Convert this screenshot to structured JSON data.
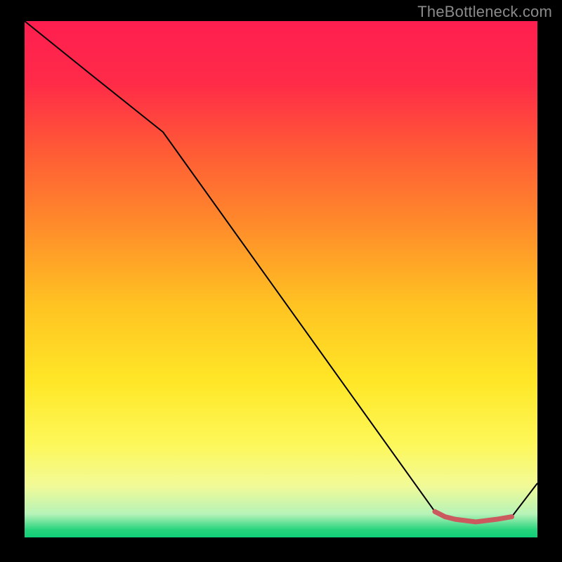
{
  "watermark": "TheBottleneck.com",
  "chart_data": {
    "type": "line",
    "title": "",
    "xlabel": "",
    "ylabel": "",
    "xlim": [
      0,
      100
    ],
    "ylim": [
      0,
      100
    ],
    "grid": false,
    "legend": false,
    "gradient_stops": [
      {
        "offset": 0.0,
        "color": "#ff1e50"
      },
      {
        "offset": 0.12,
        "color": "#ff2b48"
      },
      {
        "offset": 0.25,
        "color": "#ff5a36"
      },
      {
        "offset": 0.4,
        "color": "#ff8d2a"
      },
      {
        "offset": 0.55,
        "color": "#ffc322"
      },
      {
        "offset": 0.7,
        "color": "#ffe727"
      },
      {
        "offset": 0.82,
        "color": "#fdf85a"
      },
      {
        "offset": 0.9,
        "color": "#f2fa97"
      },
      {
        "offset": 0.955,
        "color": "#b6f3b8"
      },
      {
        "offset": 0.985,
        "color": "#28d47e"
      },
      {
        "offset": 1.0,
        "color": "#0fcf79"
      }
    ],
    "series": [
      {
        "name": "curve",
        "color": "#000000",
        "stroke_width": 2,
        "x": [
          0.0,
          12.5,
          27.0,
          80.0,
          82.0,
          84.0,
          88.0,
          92.0,
          95.0,
          100.0
        ],
        "values": [
          100.0,
          90.0,
          78.5,
          5.0,
          4.0,
          3.5,
          3.0,
          3.5,
          4.0,
          10.5
        ]
      },
      {
        "name": "valley-highlight",
        "color": "#cb5a5f",
        "stroke_width": 7,
        "linecap": "round",
        "x": [
          80.0,
          82.0,
          84.0,
          88.0,
          92.0,
          95.0
        ],
        "values": [
          5.0,
          4.0,
          3.5,
          3.0,
          3.5,
          4.0
        ]
      }
    ]
  }
}
